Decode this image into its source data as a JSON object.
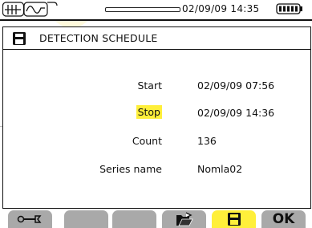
{
  "status": {
    "datetime": "02/09/09 14:35"
  },
  "window": {
    "title": "DETECTION SCHEDULE"
  },
  "fields": {
    "start_label": "Start",
    "start_value": "02/09/09 07:56",
    "stop_label": "Stop",
    "stop_value": "02/09/09 14:36",
    "count_label": "Count",
    "count_value": "136",
    "series_label": "Series name",
    "series_value": "Nomla02"
  },
  "function_keys": {
    "ok_label": "OK",
    "active_color": "#ffef3a",
    "inactive_color": "#a9a9a9"
  },
  "icons": {
    "status_icons": [
      "waveform-icon",
      "harmonics-icon"
    ],
    "battery": "battery-icon",
    "header": "save-icon",
    "keys": [
      "wrench-icon",
      "",
      "",
      "open-folder-icon",
      "save-icon",
      ""
    ]
  }
}
